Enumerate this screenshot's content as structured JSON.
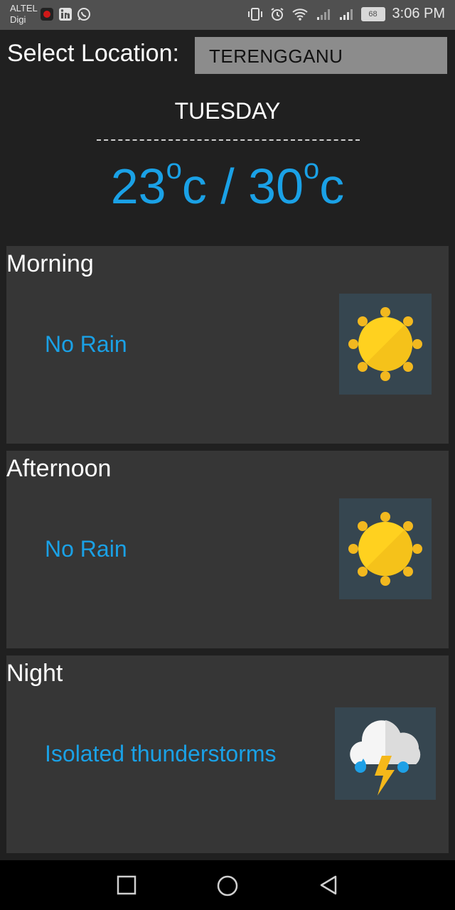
{
  "status_bar": {
    "carrier_1": "ALTEL",
    "carrier_2": "Digi",
    "battery": "68",
    "time": "3:06 PM"
  },
  "location": {
    "label": "Select Location:",
    "value": "TERENGGANU"
  },
  "day": "TUESDAY",
  "temperature": {
    "low": "23",
    "high": "30",
    "degree_symbol": "o",
    "unit": "c",
    "separator": "/"
  },
  "periods": [
    {
      "title": "Morning",
      "forecast": "No Rain",
      "icon": "sun-icon"
    },
    {
      "title": "Afternoon",
      "forecast": "No Rain",
      "icon": "sun-icon"
    },
    {
      "title": "Night",
      "forecast": "Isolated thunderstorms",
      "icon": "thunderstorm-icon"
    }
  ],
  "colors": {
    "accent": "#1aa1e6",
    "card": "#363636",
    "background": "#202020",
    "icon_bg": "#364650"
  }
}
